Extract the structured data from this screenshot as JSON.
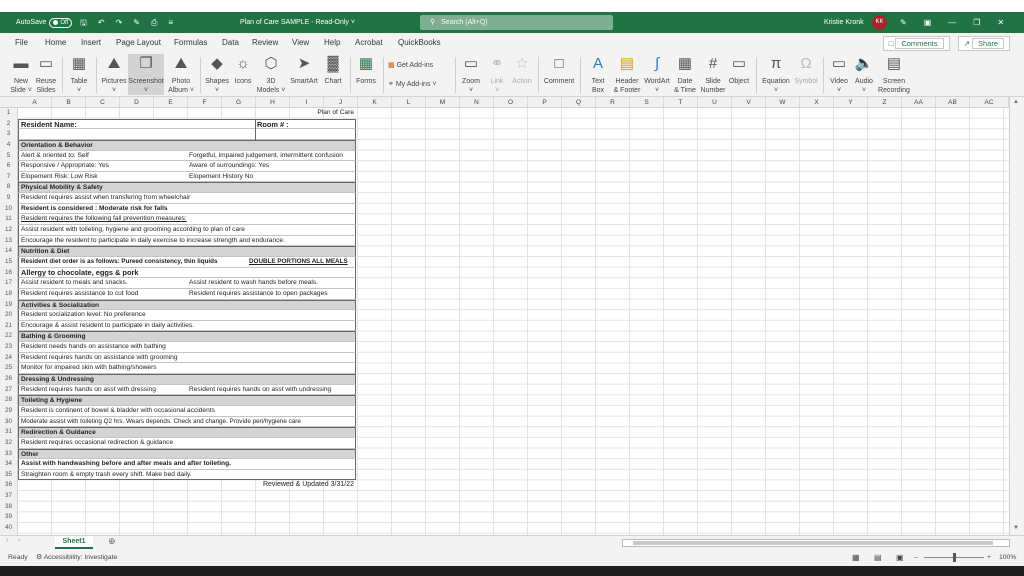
{
  "titlebar": {
    "autosave_label": "AutoSave",
    "autosave_state": "Off",
    "document_title": "Plan of Care SAMPLE  -  Read-Only ˅",
    "search_placeholder": "Search (Alt+Q)",
    "user_name": "Kristie Kronk",
    "user_initials": "KK"
  },
  "menu": {
    "tabs": [
      "File",
      "Home",
      "Insert",
      "Page Layout",
      "Formulas",
      "Data",
      "Review",
      "View",
      "Help",
      "Acrobat",
      "QuickBooks"
    ],
    "comments": "Comments",
    "share": "Share"
  },
  "ribbon": {
    "new_slide": "New\nSlide ˅",
    "reuse_slides": "Reuse\nSlides",
    "table": "Table\n˅",
    "pictures": "Pictures\n˅",
    "screenshot": "Screenshot\n˅",
    "photo_album": "Photo\nAlbum ˅",
    "shapes": "Shapes\n˅",
    "icons": "Icons",
    "models3d": "3D\nModels ˅",
    "smartart": "SmartArt",
    "chart": "Chart",
    "forms": "Forms",
    "get_addins": "Get Add-ins",
    "my_addins": "My Add-ins",
    "zoom": "Zoom\n˅",
    "link": "Link\n˅",
    "action": "Action",
    "comment": "Comment",
    "text_box": "Text\nBox",
    "header_footer": "Header\n& Footer",
    "wordart": "WordArt\n˅",
    "date_time": "Date\n& Time",
    "slide_number": "Slide\nNumber",
    "object": "Object",
    "equation": "Equation\n˅",
    "symbol": "Symbol",
    "video": "Video\n˅",
    "audio": "Audio\n˅",
    "screen_recording": "Screen\nRecording"
  },
  "columns": [
    "A",
    "B",
    "C",
    "D",
    "E",
    "F",
    "G",
    "H",
    "I",
    "J",
    "K",
    "L",
    "M",
    "N",
    "O",
    "P",
    "Q",
    "R",
    "S",
    "T",
    "U",
    "V",
    "W",
    "X",
    "Y",
    "Z",
    "AA",
    "AB",
    "AC"
  ],
  "rows": [
    "1",
    "2",
    "3",
    "4",
    "5",
    "6",
    "7",
    "8",
    "9",
    "10",
    "11",
    "12",
    "13",
    "14",
    "15",
    "16",
    "17",
    "18",
    "19",
    "20",
    "21",
    "22",
    "23",
    "24",
    "25",
    "26",
    "27",
    "28",
    "29",
    "30",
    "31",
    "32",
    "33",
    "34",
    "35",
    "36",
    "37",
    "38",
    "39",
    "40"
  ],
  "sheet": {
    "r1": "Plan of Care",
    "r2a": "Resident Name:",
    "r2b": "Room # :",
    "r4": "Orientation & Behavior",
    "r5a": "Alert & oriented to:   Self",
    "r5b": "Forgetful, impaired judgement, intermittent confusion",
    "r6a": "Responsive / Appropriate:  Yes",
    "r6b": "Aware of surroundings:  Yes",
    "r7a": "Elopement Risk: Low Risk",
    "r7b": "Elopement History    No",
    "r8": "Physical Mobility & Safety",
    "r9": "Resident requires assist when transfering from wheelchair",
    "r10": "Resident is considered :   Moderate risk for falls",
    "r11": "Resident requires the following fall prevention measures:",
    "r12": "Assist resident with toileting, hygiene and grooming according to plan of care",
    "r13": "Encourage the resident to participate in daily exercise to increase strength and endurance.",
    "r14": "Nutrition & Diet",
    "r15a": "Resident diet order is as follows: Pureed consistency, thin liquids",
    "r15b": "DOUBLE PORTIONS ALL MEALS",
    "r16": "Allergy to chocolate, eggs & pork",
    "r17a": "Assist resident to meals and snacks.",
    "r17b": "Assist resident to wash hands before meals.",
    "r18a": "Resident requires assistance to cut food",
    "r18b": "Resident requires assistance to open packages",
    "r19": "Activities & Socialization",
    "r20": "Resident socialization level: No preference",
    "r21": "Encourage & assist resident to participate in daily activities.",
    "r22": "Bathing & Grooming",
    "r23": "Resident needs hands on  assistance with bathing",
    "r24": "Resident requires hands on assistance with grooming",
    "r25": "Monitor for impaired skin with bathing/showers",
    "r26": "Dressing & Undressing",
    "r27a": "Resident requires hands on asst with dressing",
    "r27b": "Resident requires hands on asst with undressing",
    "r28": "Toileting & Hygiene",
    "r29": "Resident is continent of bowel & bladder with occasional accidents",
    "r30": "Moderate assist with toileting Q2 hrs.  Wears depends.  Check and change.  Provide peri/hygiene care",
    "r31": "Redirection & Guidance",
    "r32": "Resident requires occasional redirection & guidance",
    "r33": "Other",
    "r34": "Assist with handwashing before and after meals and after toileting.",
    "r35": "Straighten room & empty trash every shift.  Make bed daily.",
    "r36": "Reviewed & Updated 3/31/22"
  },
  "sheet_tab": "Sheet1",
  "status": {
    "ready": "Ready",
    "accessibility": "Accessibility: Investigate",
    "zoom": "100%"
  }
}
